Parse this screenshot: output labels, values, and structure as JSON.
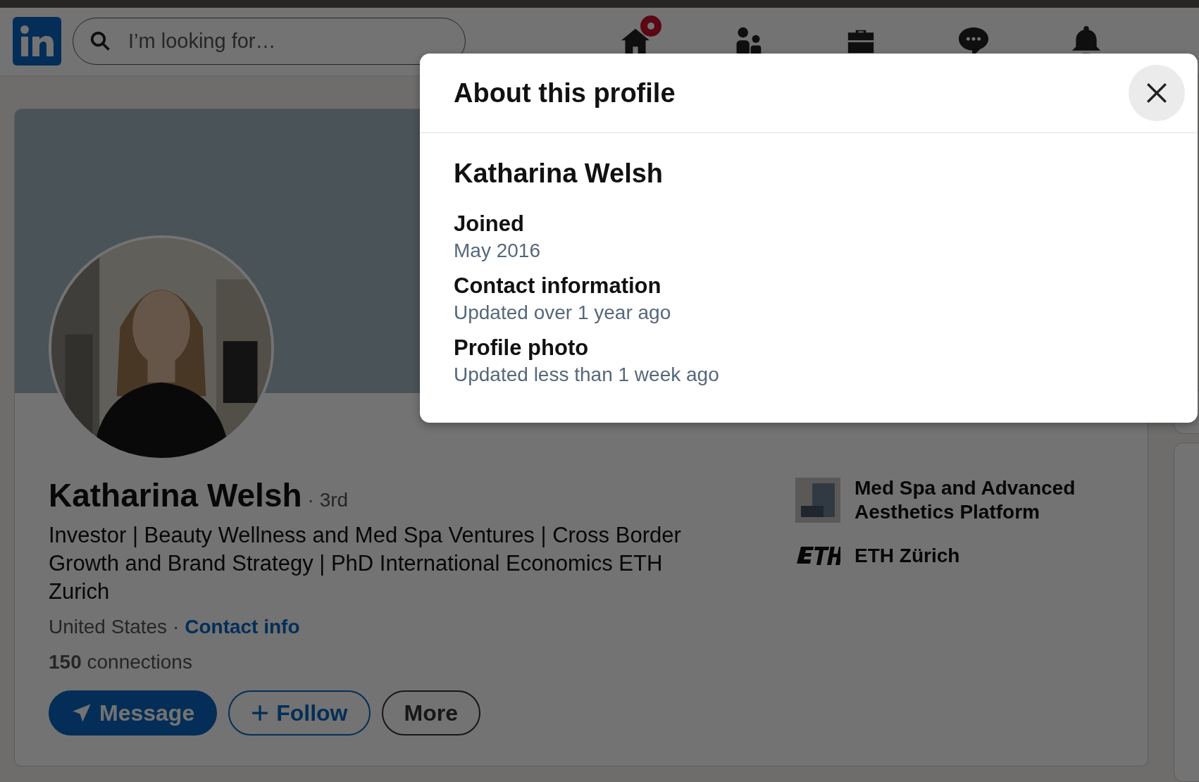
{
  "nav": {
    "search": {
      "placeholder": "I’m looking for…"
    },
    "items": [
      {
        "kind": "home",
        "badge": true
      },
      {
        "kind": "network",
        "badge": false
      },
      {
        "kind": "jobs",
        "badge": false
      },
      {
        "kind": "messaging",
        "badge": false
      },
      {
        "kind": "notifications",
        "badge": false
      }
    ]
  },
  "profile": {
    "name": "Katharina Welsh",
    "degree": "· 3rd",
    "headline": "Investor | Beauty Wellness and Med Spa Ventures | Cross Border Growth and Brand Strategy | PhD International Economics ETH Zurich",
    "location": "United States ·",
    "contact_link": "Contact info",
    "connections": "**150** connections",
    "buttons": [
      {
        "label": "Message",
        "kind": "primary"
      },
      {
        "label": "Follow",
        "kind": "secondary"
      },
      {
        "label": "More",
        "kind": "tertiary"
      }
    ],
    "organizations": [
      {
        "name": "Med Spa and Advanced Aesthetics Platform",
        "kind": "company"
      },
      {
        "name": "ETH Zürich",
        "kind": "school"
      }
    ]
  },
  "dialog": {
    "title": "About this profile",
    "name": "Katharina Welsh",
    "sections": [
      {
        "label": "Joined",
        "value": "May 2016"
      },
      {
        "label": "Contact information",
        "value": "Updated over 1 year ago"
      },
      {
        "label": "Profile photo",
        "value": "Updated less than 1 week ago"
      }
    ]
  }
}
